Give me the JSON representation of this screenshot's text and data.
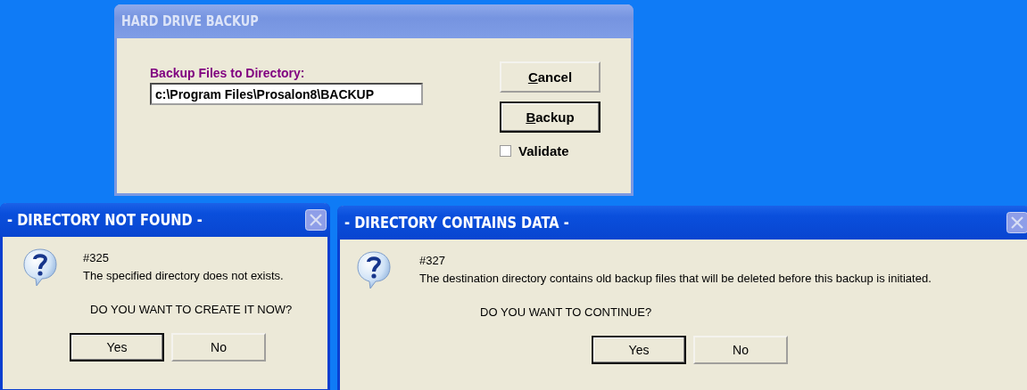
{
  "windows": [
    {
      "kind": "form",
      "title": "HARD DRIVE BACKUP",
      "active": false,
      "field_label": "Backup Files to Directory:",
      "field_value": "c:\\Program Files\\Prosalon8\\BACKUP",
      "buttons": [
        {
          "label": "Cancel",
          "default": false,
          "underline_first": true
        },
        {
          "label": "Backup",
          "default": true,
          "underline_first": true
        }
      ],
      "checkbox": {
        "label": "Validate",
        "checked": false
      }
    },
    {
      "kind": "message",
      "title": "- DIRECTORY NOT FOUND -",
      "active": true,
      "code": "#325",
      "message": "The specified directory does not exists.",
      "question": "DO YOU WANT TO CREATE IT NOW?",
      "buttons": [
        {
          "label": "Yes",
          "default": true
        },
        {
          "label": "No",
          "default": false
        }
      ]
    },
    {
      "kind": "message",
      "title": "- DIRECTORY CONTAINS DATA -",
      "active": true,
      "code": "#327",
      "message": "The destination directory contains old backup files that will be deleted before this backup is initiated.",
      "question": "DO YOU WANT TO CONTINUE?",
      "buttons": [
        {
          "label": "Yes",
          "default": true
        },
        {
          "label": "No",
          "default": false
        }
      ]
    }
  ]
}
